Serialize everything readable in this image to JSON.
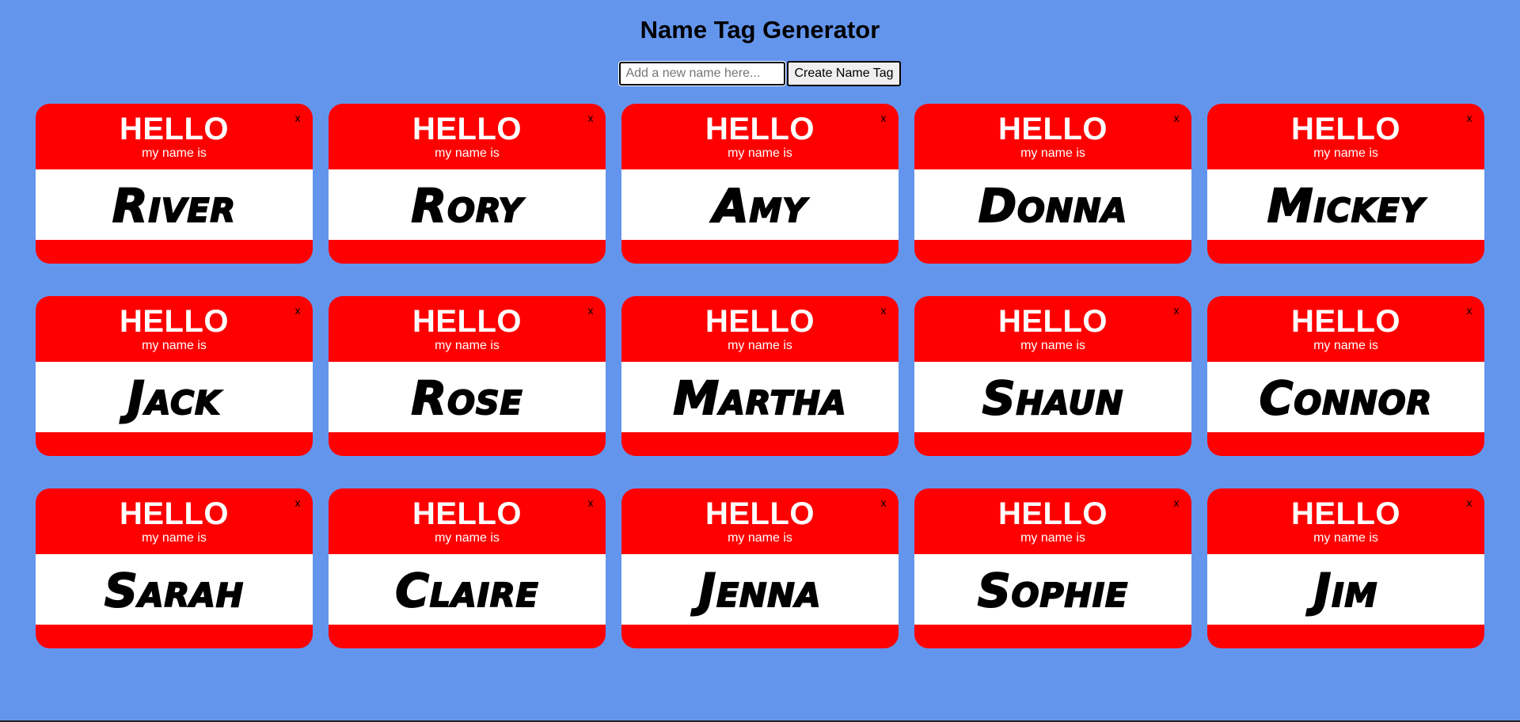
{
  "header": {
    "title": "Name Tag Generator"
  },
  "form": {
    "input_placeholder": "Add a new name here...",
    "input_value": "",
    "create_button_label": "Create Name Tag"
  },
  "tag_text": {
    "hello": "HELLO",
    "subtitle": "my name is",
    "close": "x"
  },
  "tags": [
    {
      "name": "River"
    },
    {
      "name": "Rory"
    },
    {
      "name": "Amy"
    },
    {
      "name": "Donna"
    },
    {
      "name": "Mickey"
    },
    {
      "name": "Jack"
    },
    {
      "name": "Rose"
    },
    {
      "name": "Martha"
    },
    {
      "name": "Shaun"
    },
    {
      "name": "Connor"
    },
    {
      "name": "Sarah"
    },
    {
      "name": "Claire"
    },
    {
      "name": "Jenna"
    },
    {
      "name": "Sophie"
    },
    {
      "name": "Jim"
    }
  ],
  "colors": {
    "background": "#6495ed",
    "tag_red": "#ff0000",
    "tag_white": "#ffffff"
  }
}
